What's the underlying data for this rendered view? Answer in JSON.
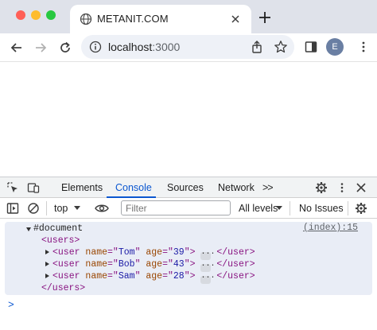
{
  "browser": {
    "tab": {
      "title": "METANIT.COM",
      "icon": "globe-icon"
    },
    "address_bar": {
      "host": "localhost",
      "port": ":3000"
    },
    "profile_initial": "E"
  },
  "devtools": {
    "tabs": [
      {
        "label": "Elements"
      },
      {
        "label": "Console",
        "active": true
      },
      {
        "label": "Sources"
      },
      {
        "label": "Network"
      }
    ],
    "more_tabs_label": ">>",
    "filter": {
      "context": "top",
      "placeholder": "Filter",
      "levels": "All levels",
      "issues": "No Issues"
    },
    "console": {
      "source_link": "(index):15",
      "document_label": "#document",
      "users_open": "<users>",
      "users_close": "</users>",
      "users": [
        {
          "name": "Tom",
          "age": "39"
        },
        {
          "name": "Bob",
          "age": "43"
        },
        {
          "name": "Sam",
          "age": "28"
        }
      ],
      "prompt": ">"
    }
  },
  "colors": {
    "accent": "#0b57d0",
    "tag": "#881280",
    "attr_name": "#994500",
    "attr_value": "#1a1aa6",
    "message_bg": "#e9edf6"
  }
}
